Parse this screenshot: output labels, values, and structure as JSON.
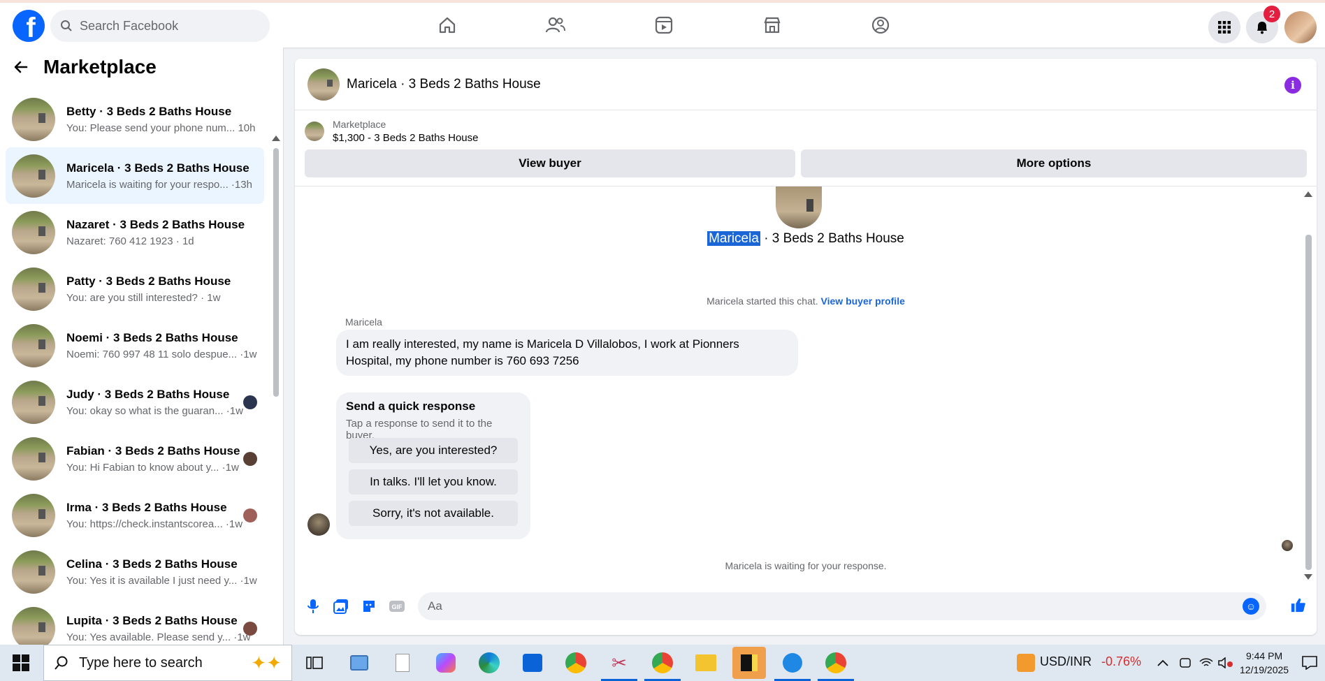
{
  "topbar": {
    "search_placeholder": "Search Facebook",
    "notifications_count": "2"
  },
  "sidebar": {
    "title": "Marketplace",
    "chats": [
      {
        "name": "Betty · 3 Beds 2 Baths House",
        "preview": "You: Please send your phone num... 10h",
        "active": false,
        "mini": false
      },
      {
        "name": "Maricela · 3 Beds 2 Baths House",
        "preview": "Maricela is waiting for your respo... ·13h",
        "active": true,
        "mini": false
      },
      {
        "name": "Nazaret · 3 Beds 2 Baths House",
        "preview": "Nazaret: 760 412 1923 · 1d",
        "active": false,
        "mini": false
      },
      {
        "name": "Patty · 3 Beds 2 Baths House",
        "preview": "You: are you still interested? · 1w",
        "active": false,
        "mini": false
      },
      {
        "name": "Noemi · 3 Beds 2 Baths House",
        "preview": "Noemi: 760 997 48 11 solo despue... ·1w",
        "active": false,
        "mini": false
      },
      {
        "name": "Judy · 3 Beds 2 Baths House",
        "preview": "You: okay so what is the guaran... ·1w",
        "active": false,
        "mini": true
      },
      {
        "name": "Fabian · 3 Beds 2 Baths House",
        "preview": "You: Hi Fabian to know about y... ·1w",
        "active": false,
        "mini": true
      },
      {
        "name": "Irma · 3 Beds 2 Baths House",
        "preview": "You: https://check.instantscorea... ·1w",
        "active": false,
        "mini": true
      },
      {
        "name": "Celina · 3 Beds 2 Baths House",
        "preview": "You: Yes it is available I just need y... ·1w",
        "active": false,
        "mini": false
      },
      {
        "name": "Lupita · 3 Beds 2 Baths House",
        "preview": "You: Yes available. Please send y... ·1w",
        "active": false,
        "mini": true
      }
    ]
  },
  "chat": {
    "title": "Maricela · 3 Beds 2 Baths House",
    "listing_source": "Marketplace",
    "listing_title": "$1,300 - 3 Beds 2 Baths House",
    "view_buyer_label": "View buyer",
    "more_options_label": "More options",
    "thread_name": "Maricela",
    "thread_suffix": " · 3 Beds 2 Baths House",
    "started_text": "Maricela started this chat. ",
    "view_profile_link": "View buyer profile",
    "sender": "Maricela",
    "message": "I am really interested, my name is Maricela D Villalobos, I work at Pionners Hospital, my phone number is 760 693 7256",
    "quick_title": "Send a quick response",
    "quick_sub": "Tap a response to send it to the buyer.",
    "quick_responses": [
      "Yes, are you interested?",
      "In talks. I'll let you know.",
      "Sorry, it's not available."
    ],
    "waiting_text": "Maricela is waiting for your response.",
    "input_placeholder": "Aa"
  },
  "taskbar": {
    "search_placeholder": "Type here to search",
    "ticker_label": "USD/INR",
    "ticker_value": "-0.76%",
    "time": "9:44 PM",
    "date": "12/19/2025"
  },
  "colors": {
    "fb_blue": "#0866ff",
    "active_chat_bg": "#ebf5ff",
    "selection": "#1a66d6",
    "badge_red": "#e41e3f"
  }
}
